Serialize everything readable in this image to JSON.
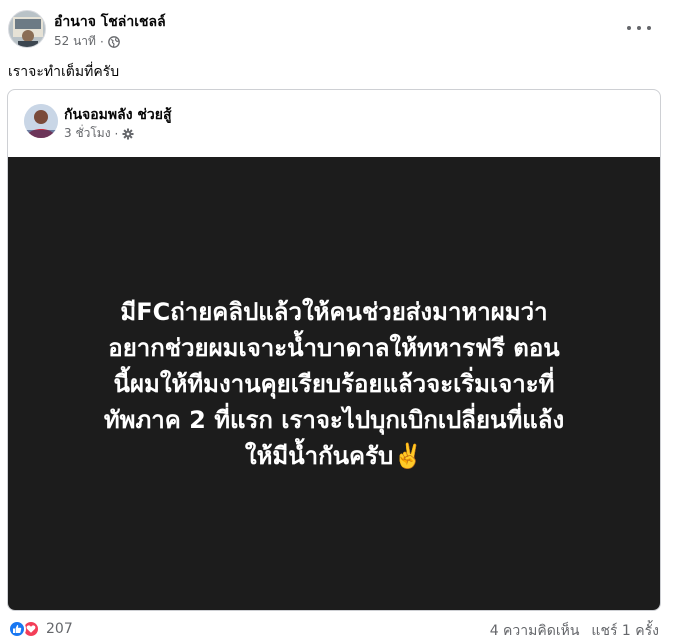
{
  "post": {
    "author_name": "อำนาจ โชล่าเชลล์",
    "time": "52 นาที",
    "meta_separator": "·",
    "caption": "เราจะทำเต็มที่ครับ"
  },
  "shared_post": {
    "author_name": "กันจอมพลัง ช่วยสู้",
    "time": "3 ชั่วโมง",
    "meta_separator": "·",
    "image_text": "มีFCถ่ายคลิปแล้วให้คนช่วยส่งมาหาผมว่า\nอยากช่วยผมเจาะน้ำบาดาลให้ทหารฟรี ตอน\nนี้ผมให้ทีมงานคุยเรียบร้อยแล้วจะเริ่มเจาะที่\nทัพภาค 2 ที่แรก เราจะไปบุกเบิกเปลี่ยนที่แล้ง\nให้มีน้ำกันครับ✌️"
  },
  "footer": {
    "reaction_count": "207",
    "comments": "4 ความคิดเห็น",
    "shares": "แชร์ 1 ครั้ง"
  },
  "icons": {
    "privacy": "globe-icon",
    "shared_privacy": "gear-icon",
    "menu": "more-options-icon",
    "reactions": [
      "like-icon",
      "love-icon"
    ]
  },
  "colors": {
    "like": "#1877f2",
    "love": "#f33e58",
    "image_background": "#1c1c1c",
    "secondary_text": "#65676b"
  }
}
